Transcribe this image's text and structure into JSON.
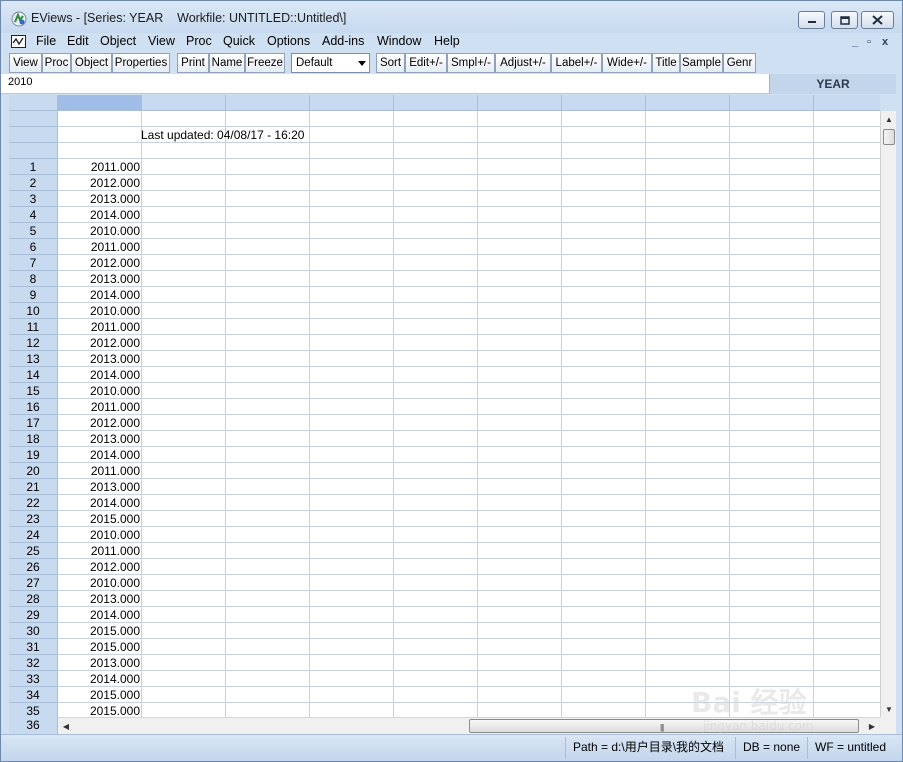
{
  "window": {
    "title": "EViews - [Series: YEAR    Workfile: UNTITLED::Untitled\\]"
  },
  "menu": [
    "File",
    "Edit",
    "Object",
    "View",
    "Proc",
    "Quick",
    "Options",
    "Add-ins",
    "Window",
    "Help"
  ],
  "mdi_controls": {
    "minimize": "_",
    "restore": "▫",
    "close": "x"
  },
  "toolbar": {
    "buttons_group1": [
      "View",
      "Proc",
      "Object",
      "Properties"
    ],
    "buttons_group2": [
      "Print",
      "Name",
      "Freeze"
    ],
    "display_select": "Default",
    "buttons_group3": [
      "Sort",
      "Edit+/-",
      "Smpl+/-",
      "Adjust+/-",
      "Label+/-",
      "Wide+/-",
      "Title",
      "Sample",
      "Genr"
    ]
  },
  "edit_field": {
    "value": "2010"
  },
  "series_name": "YEAR",
  "sheet": {
    "last_updated": "Last updated: 04/08/17 - 16:20",
    "rows": [
      {
        "n": "1",
        "v": "2011.000"
      },
      {
        "n": "2",
        "v": "2012.000"
      },
      {
        "n": "3",
        "v": "2013.000"
      },
      {
        "n": "4",
        "v": "2014.000"
      },
      {
        "n": "5",
        "v": "2010.000"
      },
      {
        "n": "6",
        "v": "2011.000"
      },
      {
        "n": "7",
        "v": "2012.000"
      },
      {
        "n": "8",
        "v": "2013.000"
      },
      {
        "n": "9",
        "v": "2014.000"
      },
      {
        "n": "10",
        "v": "2010.000"
      },
      {
        "n": "11",
        "v": "2011.000"
      },
      {
        "n": "12",
        "v": "2012.000"
      },
      {
        "n": "13",
        "v": "2013.000"
      },
      {
        "n": "14",
        "v": "2014.000"
      },
      {
        "n": "15",
        "v": "2010.000"
      },
      {
        "n": "16",
        "v": "2011.000"
      },
      {
        "n": "17",
        "v": "2012.000"
      },
      {
        "n": "18",
        "v": "2013.000"
      },
      {
        "n": "19",
        "v": "2014.000"
      },
      {
        "n": "20",
        "v": "2011.000"
      },
      {
        "n": "21",
        "v": "2013.000"
      },
      {
        "n": "22",
        "v": "2014.000"
      },
      {
        "n": "23",
        "v": "2015.000"
      },
      {
        "n": "24",
        "v": "2010.000"
      },
      {
        "n": "25",
        "v": "2011.000"
      },
      {
        "n": "26",
        "v": "2012.000"
      },
      {
        "n": "27",
        "v": "2010.000"
      },
      {
        "n": "28",
        "v": "2013.000"
      },
      {
        "n": "29",
        "v": "2014.000"
      },
      {
        "n": "30",
        "v": "2015.000"
      },
      {
        "n": "31",
        "v": "2015.000"
      },
      {
        "n": "32",
        "v": "2013.000"
      },
      {
        "n": "33",
        "v": "2014.000"
      },
      {
        "n": "34",
        "v": "2015.000"
      },
      {
        "n": "35",
        "v": "2015.000"
      }
    ],
    "next_row_label": "36"
  },
  "status": {
    "path": "Path = d:\\用户目录\\我的文档",
    "db": "DB = none",
    "wf": "WF = untitled"
  },
  "watermark": {
    "text": "Bai 经验",
    "url": "jingyan.baidu.com"
  },
  "colors": {
    "header_blue": "#c7daf0",
    "selected_header": "#9fbde6",
    "grid_line": "#c8d2de"
  }
}
